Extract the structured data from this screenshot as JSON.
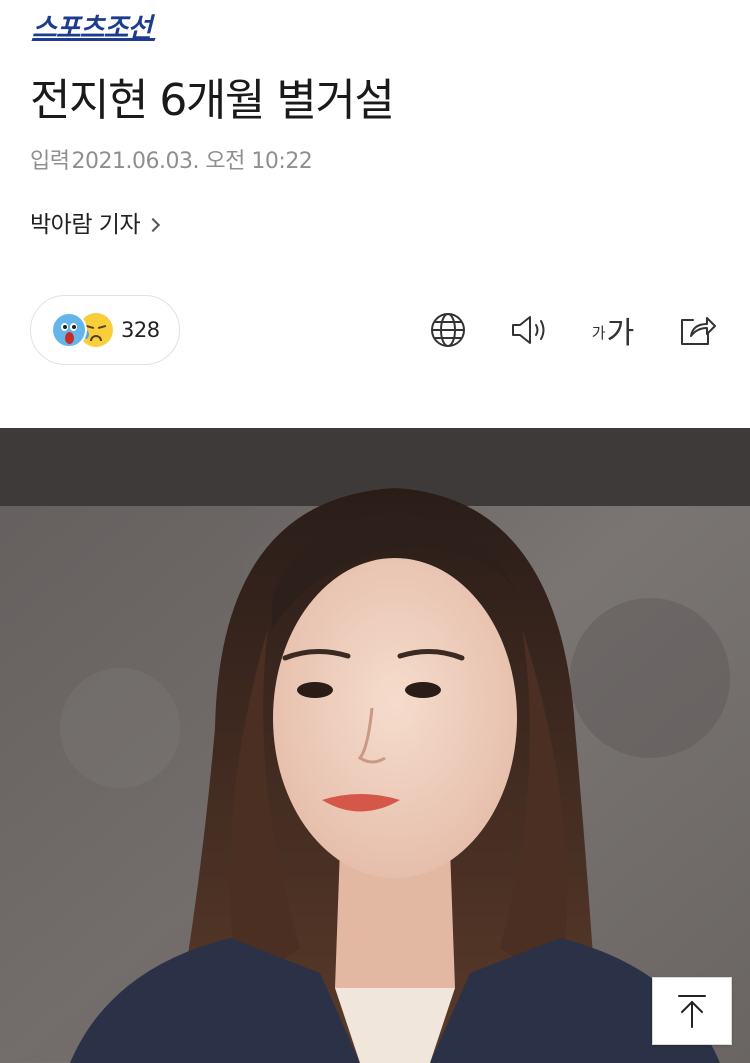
{
  "brand": {
    "logo_text": "스포츠조선",
    "color": "#1d3c8f"
  },
  "article": {
    "headline": "전지현 6개월 별거설",
    "date_label": "입력",
    "date_value": "2021.06.03. 오전 10:22",
    "reporter": "박아람 기자"
  },
  "reactions": {
    "icons": [
      "shocked-face-icon",
      "sad-face-icon"
    ],
    "count": "328"
  },
  "toolbar": {
    "icons": [
      "globe-icon",
      "speaker-icon",
      "font-size-icon",
      "share-icon"
    ],
    "font_small": "가",
    "font_large": "가"
  },
  "photo": {
    "icon": "article-photo"
  },
  "scroll_top": {
    "icon": "arrow-up-icon"
  }
}
